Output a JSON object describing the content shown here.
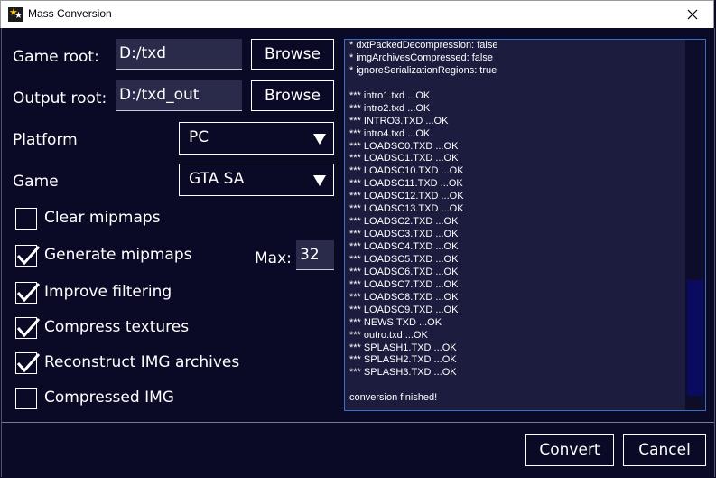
{
  "window": {
    "title": "Mass Conversion",
    "close_glyph": "✕"
  },
  "form": {
    "game_root_label": "Game root:",
    "game_root_value": "D:/txd",
    "output_root_label": "Output root:",
    "output_root_value": "D:/txd_out",
    "browse_label": "Browse",
    "platform_label": "Platform",
    "platform_value": "PC",
    "game_label": "Game",
    "game_value": "GTA SA",
    "max_label": "Max:",
    "max_value": "32"
  },
  "checkboxes": [
    {
      "label": "Clear mipmaps",
      "checked": false
    },
    {
      "label": "Generate mipmaps",
      "checked": true
    },
    {
      "label": "Improve filtering",
      "checked": true
    },
    {
      "label": "Compress textures",
      "checked": true
    },
    {
      "label": "Reconstruct IMG archives",
      "checked": true
    },
    {
      "label": "Compressed IMG",
      "checked": false
    }
  ],
  "log": [
    "* dxtPackedDecompression: false",
    "* imgArchivesCompressed: false",
    "* ignoreSerializationRegions: true",
    "",
    "*** intro1.txd ...OK",
    "*** intro2.txd ...OK",
    "*** INTRO3.TXD ...OK",
    "*** intro4.txd ...OK",
    "*** LOADSC0.TXD ...OK",
    "*** LOADSC1.TXD ...OK",
    "*** LOADSC10.TXD ...OK",
    "*** LOADSC11.TXD ...OK",
    "*** LOADSC12.TXD ...OK",
    "*** LOADSC13.TXD ...OK",
    "*** LOADSC2.TXD ...OK",
    "*** LOADSC3.TXD ...OK",
    "*** LOADSC4.TXD ...OK",
    "*** LOADSC5.TXD ...OK",
    "*** LOADSC6.TXD ...OK",
    "*** LOADSC7.TXD ...OK",
    "*** LOADSC8.TXD ...OK",
    "*** LOADSC9.TXD ...OK",
    "*** NEWS.TXD ...OK",
    "*** outro.txd ...OK",
    "*** SPLASH1.TXD ...OK",
    "*** SPLASH2.TXD ...OK",
    "*** SPLASH3.TXD ...OK",
    "",
    "conversion finished!"
  ],
  "buttons": {
    "convert_label": "Convert",
    "cancel_label": "Cancel"
  },
  "colors": {
    "background": "#0a0a26",
    "accent_border": "#3a6fc8",
    "field": "#2a2a4a"
  },
  "icons": {
    "window": "app-star-icon",
    "close": "close-icon",
    "dropdown": "chevron-down-icon",
    "check": "checkmark-icon"
  }
}
